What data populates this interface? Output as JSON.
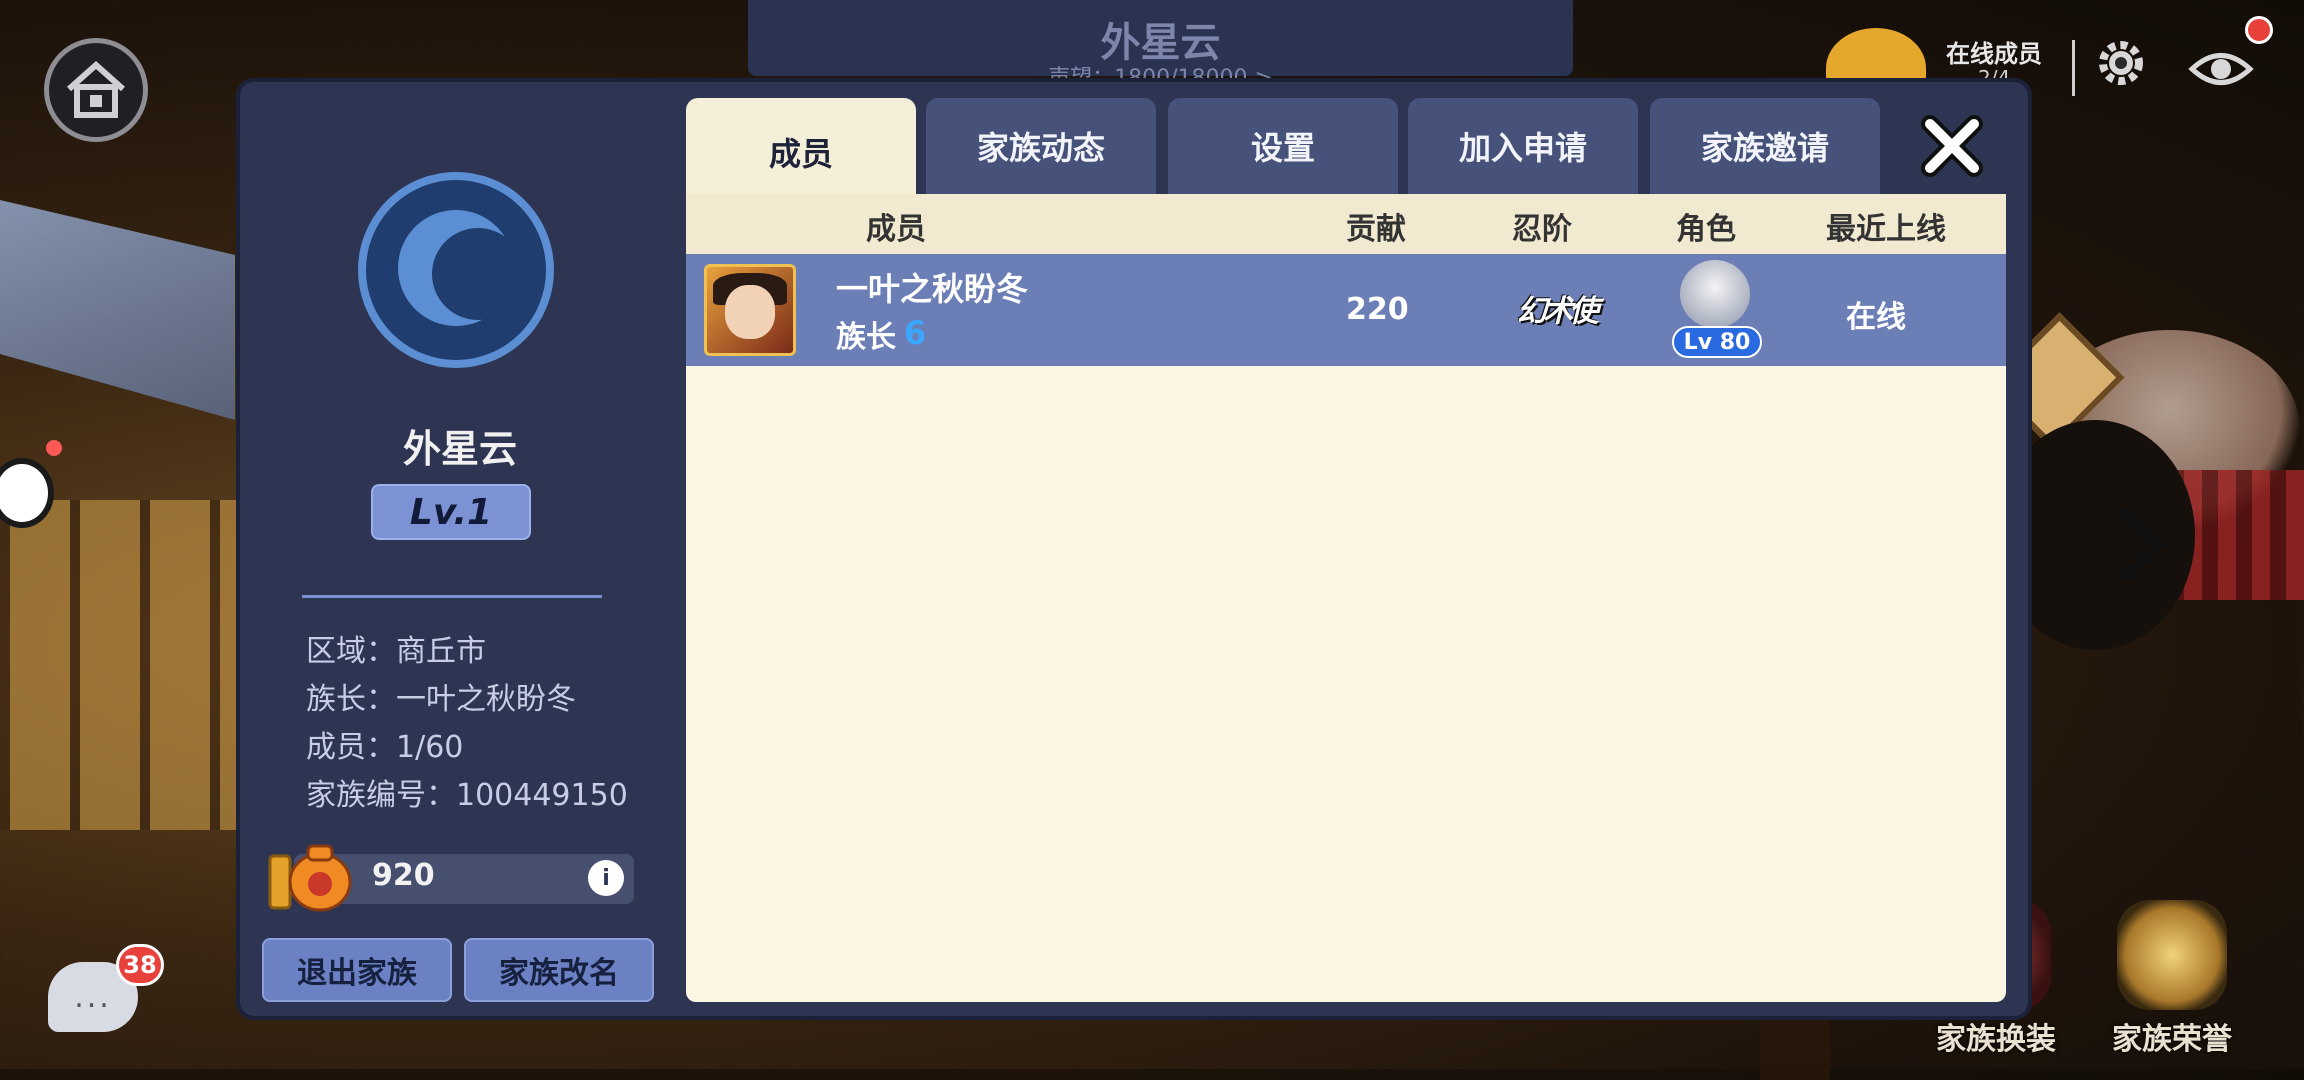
{
  "background": {
    "banner_title": "外星云",
    "banner_subtitle": "声望：1800/18000 >"
  },
  "topbar": {
    "online_label": "在线成员",
    "online_count": "2/4"
  },
  "chat": {
    "badge_count": "38",
    "glyph": "..."
  },
  "bottom_right": {
    "costume_label": "家族换装",
    "honor_label": "家族荣誉"
  },
  "clan": {
    "name": "外星云",
    "level": "Lv.1",
    "region": "区域：商丘市",
    "leader": "族长：一叶之秋盼冬",
    "members": "成员：1/60",
    "clan_id": "家族编号：100449150",
    "funds": "920",
    "info_glyph": "i",
    "quit_button": "退出家族",
    "rename_button": "家族改名"
  },
  "tabs": [
    {
      "label": "成员",
      "active": true
    },
    {
      "label": "家族动态",
      "active": false
    },
    {
      "label": "设置",
      "active": false
    },
    {
      "label": "加入申请",
      "active": false
    },
    {
      "label": "家族邀请",
      "active": false
    }
  ],
  "table": {
    "headers": {
      "member": "成员",
      "contribution": "贡献",
      "rank": "忍阶",
      "role": "角色",
      "last_online": "最近上线"
    },
    "rows": [
      {
        "name": "一叶之秋盼冬",
        "title": "族长",
        "title_icon": "6",
        "contribution": "220",
        "rank": "幻术使",
        "level": "Lv 80",
        "status": "在线"
      }
    ]
  },
  "colors": {
    "panel": "#2d3553",
    "tab_active": "#f4efd8",
    "tab_inactive": "#46527a",
    "row_highlight": "#6c7eb6",
    "level_badge": "#7d92d4"
  }
}
